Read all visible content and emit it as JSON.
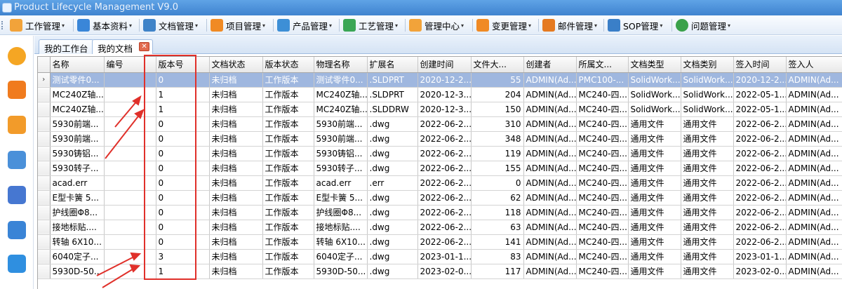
{
  "app": {
    "title": "Product Lifecycle Management V9.0"
  },
  "menu": [
    {
      "label": "工作管理",
      "icon": "work-icon"
    },
    {
      "label": "基本资料",
      "icon": "document-icon"
    },
    {
      "label": "文档管理",
      "icon": "folder-icon"
    },
    {
      "label": "项目管理",
      "icon": "project-icon"
    },
    {
      "label": "产品管理",
      "icon": "box-icon"
    },
    {
      "label": "工艺管理",
      "icon": "process-icon"
    },
    {
      "label": "管理中心",
      "icon": "gear-icon"
    },
    {
      "label": "变更管理",
      "icon": "change-icon"
    },
    {
      "label": "邮件管理",
      "icon": "mail-icon"
    },
    {
      "label": "SOP管理",
      "icon": "sop-icon"
    },
    {
      "label": "问题管理",
      "icon": "help-icon"
    }
  ],
  "tabs": {
    "home": "我的工作台",
    "active": "我的文档"
  },
  "table": {
    "columns": [
      "名称",
      "编号",
      "版本号",
      "文档状态",
      "版本状态",
      "物理名称",
      "扩展名",
      "创建时间",
      "文件大...",
      "创建者",
      "所属文...",
      "文档类型",
      "文档类别",
      "签入时间",
      "签入人"
    ],
    "rows": [
      [
        "测试零件0...",
        "",
        "0",
        "未归档",
        "工作版本",
        "测试零件0...",
        ".SLDPRT",
        "2020-12-2...",
        "55",
        "ADMIN(Ad...",
        "PMC100-...",
        "SolidWork...",
        "SolidWork...",
        "2020-12-2...",
        "ADMIN(Ad..."
      ],
      [
        "MC240Z轴...",
        "",
        "1",
        "未归档",
        "工作版本",
        "MC240Z轴...",
        ".SLDPRT",
        "2020-12-3...",
        "204",
        "ADMIN(Ad...",
        "MC240-四...",
        "SolidWork...",
        "SolidWork...",
        "2022-05-1...",
        "ADMIN(Ad..."
      ],
      [
        "MC240Z轴...",
        "",
        "1",
        "未归档",
        "工作版本",
        "MC240Z轴...",
        ".SLDDRW",
        "2020-12-3...",
        "150",
        "ADMIN(Ad...",
        "MC240-四...",
        "SolidWork...",
        "SolidWork...",
        "2022-05-1...",
        "ADMIN(Ad..."
      ],
      [
        "5930前端...",
        "",
        "0",
        "未归档",
        "工作版本",
        "5930前端...",
        ".dwg",
        "2022-06-2...",
        "310",
        "ADMIN(Ad...",
        "MC240-四...",
        "通用文件",
        "通用文件",
        "2022-06-2...",
        "ADMIN(Ad..."
      ],
      [
        "5930前端...",
        "",
        "0",
        "未归档",
        "工作版本",
        "5930前端...",
        ".dwg",
        "2022-06-2...",
        "348",
        "ADMIN(Ad...",
        "MC240-四...",
        "通用文件",
        "通用文件",
        "2022-06-2...",
        "ADMIN(Ad..."
      ],
      [
        "5930铸铝...",
        "",
        "0",
        "未归档",
        "工作版本",
        "5930铸铝...",
        ".dwg",
        "2022-06-2...",
        "119",
        "ADMIN(Ad...",
        "MC240-四...",
        "通用文件",
        "通用文件",
        "2022-06-2...",
        "ADMIN(Ad..."
      ],
      [
        "5930转子...",
        "",
        "0",
        "未归档",
        "工作版本",
        "5930转子...",
        ".dwg",
        "2022-06-2...",
        "155",
        "ADMIN(Ad...",
        "MC240-四...",
        "通用文件",
        "通用文件",
        "2022-06-2...",
        "ADMIN(Ad..."
      ],
      [
        "acad.err",
        "",
        "0",
        "未归档",
        "工作版本",
        "acad.err",
        ".err",
        "2022-06-2...",
        "0",
        "ADMIN(Ad...",
        "MC240-四...",
        "通用文件",
        "通用文件",
        "2022-06-2...",
        "ADMIN(Ad..."
      ],
      [
        "E型卡簧 5...",
        "",
        "0",
        "未归档",
        "工作版本",
        "E型卡簧 5...",
        ".dwg",
        "2022-06-2...",
        "62",
        "ADMIN(Ad...",
        "MC240-四...",
        "通用文件",
        "通用文件",
        "2022-06-2...",
        "ADMIN(Ad..."
      ],
      [
        "护线圈Φ8...",
        "",
        "0",
        "未归档",
        "工作版本",
        "护线圈Φ8...",
        ".dwg",
        "2022-06-2...",
        "118",
        "ADMIN(Ad...",
        "MC240-四...",
        "通用文件",
        "通用文件",
        "2022-06-2...",
        "ADMIN(Ad..."
      ],
      [
        "接地标贴....",
        "",
        "0",
        "未归档",
        "工作版本",
        "接地标贴....",
        ".dwg",
        "2022-06-2...",
        "63",
        "ADMIN(Ad...",
        "MC240-四...",
        "通用文件",
        "通用文件",
        "2022-06-2...",
        "ADMIN(Ad..."
      ],
      [
        "转轴 6X10...",
        "",
        "0",
        "未归档",
        "工作版本",
        "转轴 6X10...",
        ".dwg",
        "2022-06-2...",
        "141",
        "ADMIN(Ad...",
        "MC240-四...",
        "通用文件",
        "通用文件",
        "2022-06-2...",
        "ADMIN(Ad..."
      ],
      [
        "6040定子...",
        "",
        "3",
        "未归档",
        "工作版本",
        "6040定子...",
        ".dwg",
        "2023-01-1...",
        "83",
        "ADMIN(Ad...",
        "MC240-四...",
        "通用文件",
        "通用文件",
        "2023-01-1...",
        "ADMIN(Ad..."
      ],
      [
        "5930D-50...",
        "",
        "1",
        "未归档",
        "工作版本",
        "5930D-50...",
        ".dwg",
        "2023-02-0...",
        "117",
        "ADMIN(Ad...",
        "MC240-四...",
        "通用文件",
        "通用文件",
        "2023-02-0...",
        "ADMIN(Ad..."
      ]
    ],
    "selected_row": 0
  },
  "colors": {
    "selection": "#9fb7df",
    "annotation": "#e0302a",
    "titlebar": "#4a8fd8"
  }
}
